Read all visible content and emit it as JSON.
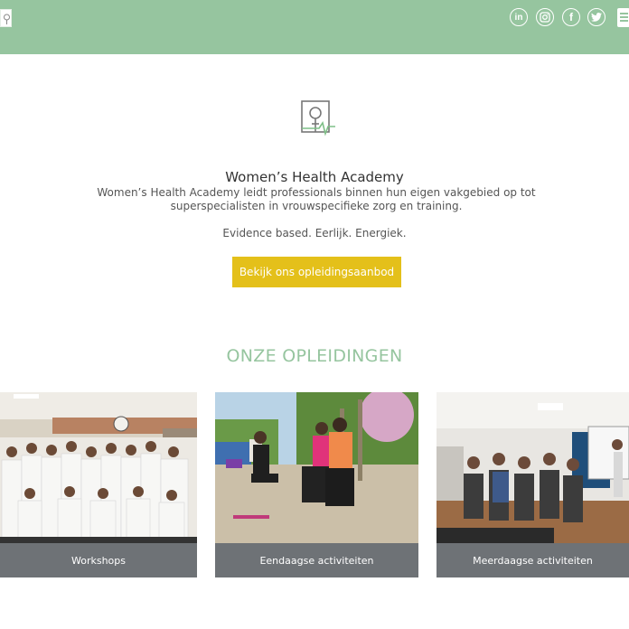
{
  "header": {
    "social": [
      {
        "name": "linkedin",
        "glyph": "in"
      },
      {
        "name": "instagram",
        "glyph": ""
      },
      {
        "name": "facebook",
        "glyph": "f"
      },
      {
        "name": "twitter",
        "glyph": ""
      }
    ],
    "bg_color": "#96c59f"
  },
  "hero": {
    "title": "Women’s Health Academy",
    "description": "Women’s Health Academy leidt professionals binnen hun eigen vakgebied op tot superspecialisten in vrouwspecifieke zorg en training.",
    "tagline": "Evidence based. Eerlijk. Energiek.",
    "cta_label": "Bekijk ons opleidingsaanbod",
    "cta_color": "#e4c01a"
  },
  "courses": {
    "title": "ONZE OPLEIDINGEN",
    "cards": [
      {
        "label": "Workshops"
      },
      {
        "label": "Eendaagse activiteiten"
      },
      {
        "label": "Meerdaagse activiteiten"
      }
    ]
  }
}
